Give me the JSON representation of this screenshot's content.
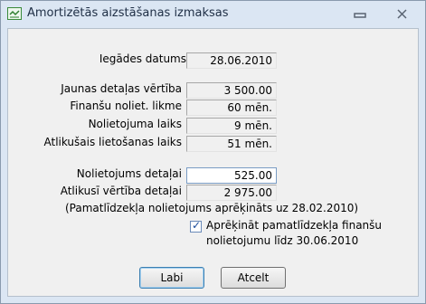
{
  "window": {
    "title": "Amortizētās aizstāšanas izmaksas",
    "min_icon": "minimize-icon",
    "close_icon": "close-icon"
  },
  "fields": {
    "purchase_date_label": "Iegādes datums",
    "purchase_date_value": "28.06.2010",
    "new_part_value_label": "Jaunas detaļas vērtība",
    "new_part_value": "3 500.00",
    "depr_rate_label": "Finanšu noliet. likme",
    "depr_rate_value": "60 mēn.",
    "depr_time_label": "Nolietojuma laiks",
    "depr_time_value": "9 mēn.",
    "remaining_label": "Atlikušais lietošanas laiks",
    "remaining_value": "51 mēn.",
    "part_depr_label": "Nolietojums detaļai",
    "part_depr_value": "525.00",
    "residual_label": "Atlikusī vērtība detaļai",
    "residual_value": "2 975.00"
  },
  "note": "(Pamatlīdzekļa nolietojums aprēķināts uz 28.02.2010)",
  "checkbox": {
    "checked": true,
    "line1": "Aprēķināt pamatlīdzekļa finanšu",
    "line2": "nolietojumu līdz 30.06.2010"
  },
  "buttons": {
    "ok": "Labi",
    "cancel": "Atcelt"
  }
}
